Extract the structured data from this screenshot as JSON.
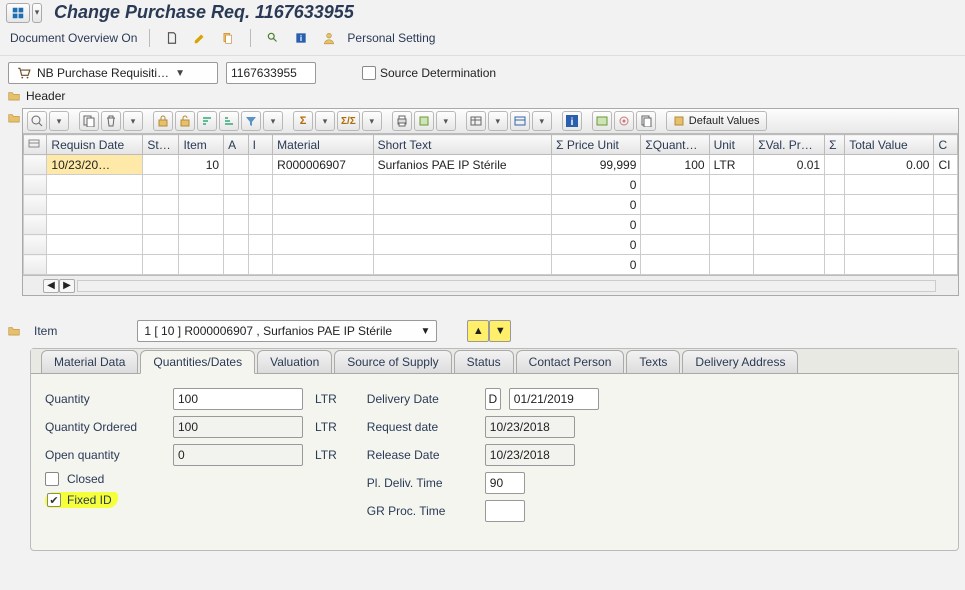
{
  "title": "Change Purchase Req. 1167633955",
  "toolbar": {
    "doc_overview": "Document Overview On",
    "personal_setting": "Personal Setting"
  },
  "selector": {
    "type_label": "NB Purchase Requisiti…",
    "doc_number": "1167633955",
    "source_det": "Source Determination"
  },
  "header_label": "Header",
  "grid": {
    "default_values": "Default Values",
    "columns": [
      "Requisn Date",
      "St…",
      "Item",
      "A",
      "I",
      "Material",
      "Short Text",
      "Σ Price Unit",
      "ΣQuant…",
      "Unit",
      "ΣVal. Pr…",
      "Σ",
      "Total Value",
      "C"
    ],
    "row": {
      "req_date": "10/23/20…",
      "status": "",
      "item": "10",
      "a": "",
      "i": "",
      "material": "R000006907",
      "short_text": "Surfanios PAE IP Stérile",
      "price_unit": "99,999",
      "quant": "100",
      "unit": "LTR",
      "val_pr": "0.01",
      "sigma": "",
      "total_value": "0.00",
      "c": "CI"
    },
    "zeros": [
      "0",
      "0",
      "0",
      "0",
      "0"
    ]
  },
  "item_section": {
    "label": "Item",
    "selected": "1 [ 10 ] R000006907 , Surfanios PAE IP Stérile"
  },
  "tabs": [
    "Material Data",
    "Quantities/Dates",
    "Valuation",
    "Source of Supply",
    "Status",
    "Contact Person",
    "Texts",
    "Delivery Address"
  ],
  "active_tab": 1,
  "qty_dates": {
    "qty_label": "Quantity",
    "qty_value": "100",
    "qty_unit": "LTR",
    "qty_ord_label": "Quantity Ordered",
    "qty_ord_value": "100",
    "qty_ord_unit": "LTR",
    "open_label": "Open quantity",
    "open_value": "0",
    "open_unit": "LTR",
    "closed_label": "Closed",
    "fixed_label": "Fixed ID",
    "deliv_date_label": "Delivery Date",
    "deliv_date_cat": "D",
    "deliv_date_value": "01/21/2019",
    "request_label": "Request date",
    "request_value": "10/23/2018",
    "release_label": "Release Date",
    "release_value": "10/23/2018",
    "pl_deliv_label": "Pl. Deliv. Time",
    "pl_deliv_value": "90",
    "gr_proc_label": "GR Proc. Time",
    "gr_proc_value": ""
  }
}
